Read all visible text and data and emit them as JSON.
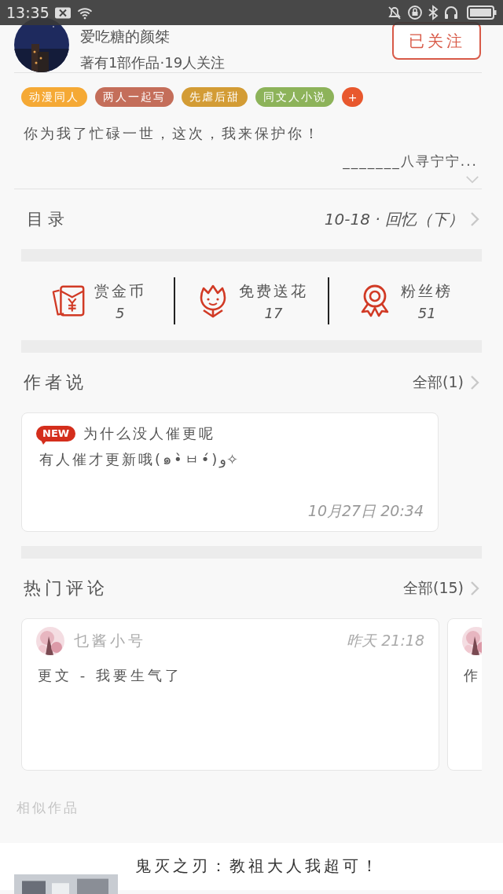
{
  "status_bar": {
    "time": "13:35"
  },
  "author": {
    "name": "爱吃糖的颜桀",
    "summary": "著有1部作品·19人关注",
    "follow_button": "已关注",
    "followed": true
  },
  "tags": [
    {
      "label": "动漫同人",
      "color": "#f5a935"
    },
    {
      "label": "两人一起写",
      "color": "#c46e5a"
    },
    {
      "label": "先虐后甜",
      "color": "#d39c35"
    },
    {
      "label": "同文人小说",
      "color": "#8db35a"
    },
    {
      "label": "+",
      "color": "#e8582e"
    }
  ],
  "intro": {
    "quote": "你为我了忙碌一世，这次，我来保护你！",
    "signature": "_______八寻宁宁..."
  },
  "catalog": {
    "label": "目录",
    "latest": "10-18 · 回忆（下）"
  },
  "stats": [
    {
      "kind": "coin",
      "label": "赏金币",
      "value": "5"
    },
    {
      "kind": "flower",
      "label": "免费送花",
      "value": "17"
    },
    {
      "kind": "fans",
      "label": "粉丝榜",
      "value": "51"
    }
  ],
  "author_notes": {
    "title": "作者说",
    "all_link": "全部(1)",
    "notes": [
      {
        "badge": "NEW",
        "title": "为什么没人催更呢",
        "text": "有人催才更新哦(๑•̀ㅂ•́)و✧",
        "time": "10月27日  20:34"
      }
    ]
  },
  "hot_comments": {
    "title": "热门评论",
    "all_link": "全部(15)",
    "comments": [
      {
        "user": "乜酱小号",
        "time": "昨天 21:18",
        "text": "更文 - 我要生气了"
      },
      {
        "text": "作"
      }
    ]
  },
  "similar": {
    "title": "相似作品",
    "works": [
      {
        "title": "鬼灭之刃：教祖大人我超可！"
      }
    ]
  }
}
